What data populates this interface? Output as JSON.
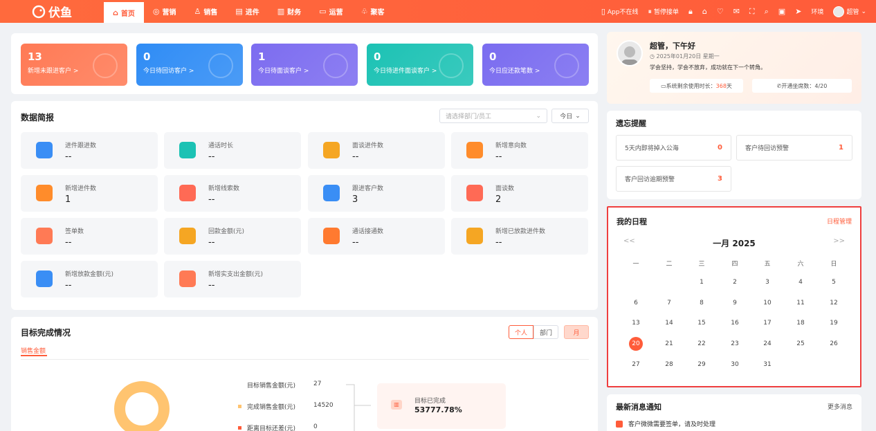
{
  "brand": {
    "name": "伏鱼",
    "color": "#ff5c3a"
  },
  "nav": [
    {
      "label": "首页",
      "icon": "home-icon",
      "active": true
    },
    {
      "label": "营销",
      "icon": "target-icon"
    },
    {
      "label": "销售",
      "icon": "user-icon"
    },
    {
      "label": "进件",
      "icon": "file-icon"
    },
    {
      "label": "财务",
      "icon": "wallet-icon"
    },
    {
      "label": "运营",
      "icon": "chat-icon"
    },
    {
      "label": "聚客",
      "icon": "group-icon"
    }
  ],
  "toolbar": {
    "app_status": "App不在线",
    "pause": "暂停接单",
    "env": "环境",
    "user": "超管"
  },
  "stats": [
    {
      "value": "13",
      "label": "新增未跟进客户 >",
      "color": "#ff7a55"
    },
    {
      "value": "0",
      "label": "今日待回访客户 >",
      "color": "#2f8cf5"
    },
    {
      "value": "1",
      "label": "今日待面谈客户 >",
      "color": "#7c6cf0"
    },
    {
      "value": "0",
      "label": "今日待进件面谈客户 >",
      "color": "#1cc2b4"
    },
    {
      "value": "0",
      "label": "今日应还款笔数 >",
      "color": "#7a6cf0"
    }
  ],
  "brief": {
    "title": "数据简报",
    "select_placeholder": "请选择部门/员工",
    "period": "今日",
    "metrics": [
      {
        "label": "进件跟进数",
        "value": "--",
        "color": "#3a8ef5"
      },
      {
        "label": "通话时长",
        "value": "--",
        "color": "#1cc2b4"
      },
      {
        "label": "面谈进件数",
        "value": "--",
        "color": "#f5a623"
      },
      {
        "label": "新增意向数",
        "value": "--",
        "color": "#ff8c2b"
      },
      {
        "label": "新增进件数",
        "value": "1",
        "color": "#ff8c2b"
      },
      {
        "label": "新增线索数",
        "value": "--",
        "color": "#ff6a55"
      },
      {
        "label": "跟进客户数",
        "value": "3",
        "color": "#3a8ef5"
      },
      {
        "label": "面谈数",
        "value": "2",
        "color": "#ff6a55"
      },
      {
        "label": "签单数",
        "value": "--",
        "color": "#ff7a55"
      },
      {
        "label": "回款金额(元)",
        "value": "--",
        "color": "#f5a623"
      },
      {
        "label": "通话接通数",
        "value": "--",
        "color": "#ff7a30"
      },
      {
        "label": "新增已放款进件数",
        "value": "--",
        "color": "#f5a623"
      },
      {
        "label": "新增放款金额(元)",
        "value": "--",
        "color": "#3a8ef5"
      },
      {
        "label": "新增实支出金额(元)",
        "value": "--",
        "color": "#ff7a55"
      }
    ]
  },
  "goal": {
    "title": "目标完成情况",
    "tabs": [
      "个人",
      "部门"
    ],
    "month": "月",
    "sub_tab": "销售金额",
    "rows": [
      {
        "label": "目标销售金额(元)",
        "value": "27"
      },
      {
        "label": "完成销售金额(元)",
        "value": "14520"
      },
      {
        "label": "距离目标还差(元)",
        "value": "0"
      }
    ],
    "done_label": "目标已完成",
    "done_value": "53777.78%"
  },
  "profile": {
    "greeting": "超管，下午好",
    "date": "2025年01月20日 星期一",
    "motto": "学会坚持，学会不放弃，成功就在下一个转角。",
    "usage_label": "系统剩余使用时长：",
    "usage_value": "368",
    "usage_unit": " 天",
    "seats": "开通坐席数：4/20"
  },
  "memo": {
    "title": "遗忘提醒",
    "items": [
      {
        "label": "5天内即将掉入公海",
        "value": "0"
      },
      {
        "label": "客户待回访预警",
        "value": "1"
      },
      {
        "label": "客户回访逾期预警",
        "value": "3"
      }
    ]
  },
  "schedule": {
    "title": "我的日程",
    "manage": "日程管理",
    "prev": "<<",
    "next": ">>",
    "month": "一月 2025",
    "weekdays": [
      "一",
      "二",
      "三",
      "四",
      "五",
      "六",
      "日"
    ],
    "days": [
      [
        "",
        "",
        "1",
        "2",
        "3",
        "4",
        "5"
      ],
      [
        "6",
        "7",
        "8",
        "9",
        "10",
        "11",
        "12"
      ],
      [
        "13",
        "14",
        "15",
        "16",
        "17",
        "18",
        "19"
      ],
      [
        "20",
        "21",
        "22",
        "23",
        "24",
        "25",
        "26"
      ],
      [
        "27",
        "28",
        "29",
        "30",
        "31",
        "",
        ""
      ]
    ],
    "today": "20"
  },
  "news": {
    "title": "最新消息通知",
    "more": "更多消息",
    "items": [
      "客户微微需要签单，请及时处理"
    ]
  }
}
